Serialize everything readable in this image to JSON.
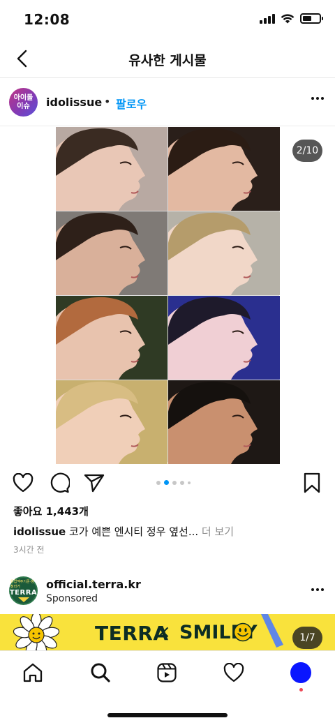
{
  "status_bar": {
    "time": "12:08"
  },
  "header": {
    "title": "유사한 게시물",
    "back_icon": "chevron-left-icon"
  },
  "post": {
    "avatar_text_line1": "아이돌",
    "avatar_text_line2": "이슈",
    "username": "idolissue",
    "dot": "•",
    "follow_label": "팔로우",
    "page_indicator": "2/10",
    "likes": "좋아요 1,443개",
    "caption_user": "idolissue",
    "caption_text": " 코가 예쁜 엔시티 정우 옆선...",
    "caption_more": " 더 보기",
    "time_ago": "3시간 전",
    "carousel_total_dots": 5,
    "carousel_active_index": 1,
    "tiles": [
      {
        "name": "photo-tile-1",
        "bg": "#b8a9a2",
        "hair": "#3a2b22",
        "skin": "#e9c7b6"
      },
      {
        "name": "photo-tile-2",
        "bg": "#2a1f1a",
        "hair": "#2b1c14",
        "skin": "#e3b9a2"
      },
      {
        "name": "photo-tile-3",
        "bg": "#7f7a76",
        "hair": "#2e2019",
        "skin": "#d9b09a"
      },
      {
        "name": "photo-tile-4",
        "bg": "#b6b2a8",
        "hair": "#b59c6b",
        "skin": "#f1d7c8"
      },
      {
        "name": "photo-tile-5",
        "bg": "#2f3a24",
        "hair": "#b26a3e",
        "skin": "#e8c3ae"
      },
      {
        "name": "photo-tile-6",
        "bg": "#2a2f8f",
        "hair": "#1e1a2b",
        "skin": "#f0cfd4"
      },
      {
        "name": "photo-tile-7",
        "bg": "#c8b06f",
        "hair": "#d8bd83",
        "skin": "#f0cfb8"
      },
      {
        "name": "photo-tile-8",
        "bg": "#1e1815",
        "hair": "#15110e",
        "skin": "#c9906f"
      }
    ]
  },
  "ad": {
    "avatar_top": "유럽맥주기준·청정라거",
    "avatar_brand": "TERRA",
    "username": "official.terra.kr",
    "sponsored": "Sponsored",
    "banner_brand1": "TERRA",
    "banner_x": "×",
    "banner_brand2": "SMILEY",
    "page_indicator": "1/7"
  },
  "tabbar": {
    "items": [
      "home-icon",
      "search-icon",
      "reels-icon",
      "heart-icon",
      "profile-avatar"
    ]
  },
  "colors": {
    "accent": "#0095f6",
    "ad_banner": "#f9e23c",
    "profile": "#0a16ff",
    "notification": "#ed4956"
  }
}
